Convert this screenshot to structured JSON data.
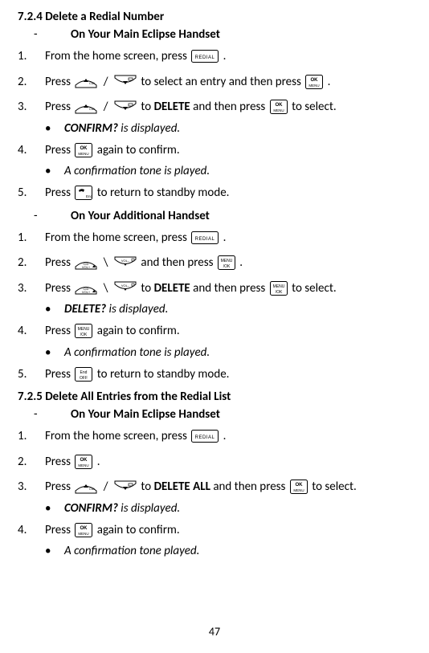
{
  "page_number": "47",
  "section724_title": "7.2.4  Delete a Redial Number",
  "dash": "-",
  "sub_main": "On Your Main Eclipse Handset",
  "sub_add": "On Your Additional Handset",
  "slash": "/",
  "bslash": "\\",
  "p724m": {
    "s1a": "From the home screen, press ",
    "s1b": ".",
    "s2a": "Press ",
    "s2b": " to select an entry and then press ",
    "s2c": ".",
    "s3a": "Press ",
    "s3b": " to ",
    "s3c": "DELETE",
    "s3d": " and then press ",
    "s3e": " to select.",
    "s3bul_a": "CONFIRM?",
    "s3bul_b": " is displayed.",
    "s4a": "Press ",
    "s4b": " again to confirm.",
    "s4bul": "A confirmation tone is played.",
    "s5a": "Press ",
    "s5b": " to return to standby mode."
  },
  "p724a": {
    "s1a": "From the home screen, press ",
    "s1b": ".",
    "s2a": "Press ",
    "s2b": " and then press ",
    "s2c": ".",
    "s3a": "Press ",
    "s3b": " to ",
    "s3c": "DELETE",
    "s3d": " and then press ",
    "s3e": " to select.",
    "s3bul_a": "DELETE?",
    "s3bul_b": " is displayed.",
    "s4a": "Press ",
    "s4b": " again to confirm.",
    "s4bul": "A confirmation tone is played.",
    "s5a": "Press ",
    "s5b": " to return to standby mode."
  },
  "section725_title": "7.2.5  Delete All Entries from the Redial List",
  "p725": {
    "s1a": "From the home screen, press ",
    "s1b": ".",
    "s2a": "Press ",
    "s2b": ".",
    "s3a": "Press ",
    "s3b": " to ",
    "s3c": "DELETE ALL",
    "s3d": " and then press ",
    "s3e": " to select.",
    "s3bul_a": "CONFIRM?",
    "s3bul_b": " is displayed.",
    "s4a": "Press ",
    "s4b": " again to confirm.",
    "s4bul": "A confirmation tone played."
  }
}
